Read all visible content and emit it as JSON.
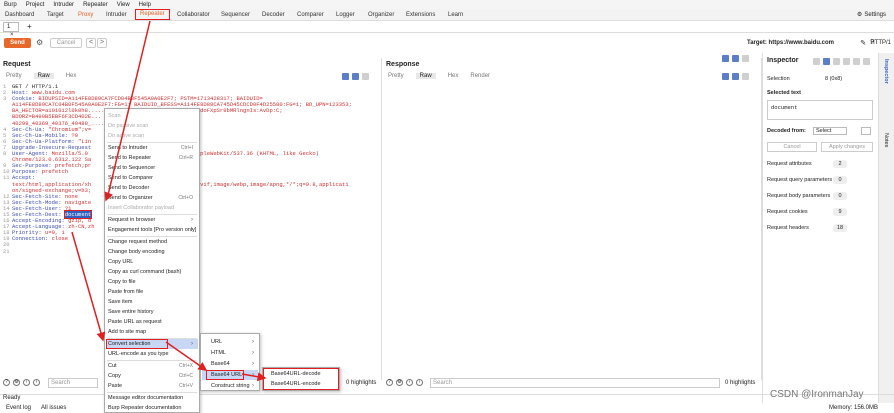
{
  "menubar": [
    "Burp",
    "Project",
    "Intruder",
    "Repeater",
    "View",
    "Help"
  ],
  "tabs": [
    "Dashboard",
    "Target",
    "Proxy",
    "Intruder",
    "Repeater",
    "Collaborator",
    "Sequencer",
    "Decoder",
    "Comparer",
    "Logger",
    "Organizer",
    "Extensions",
    "Learn"
  ],
  "settings_label": "Settings",
  "subtab": {
    "label": "1",
    "close": "×",
    "add": "+"
  },
  "toolbar": {
    "send": "Send",
    "cancel": "Cancel",
    "back": "<",
    "forward": ">",
    "target": "Target: https://www.baidu.com",
    "http": "HTTP/1"
  },
  "request": {
    "title": "Request",
    "tabs": [
      "Pretty",
      "Raw",
      "Hex"
    ],
    "lines": [
      [
        "1",
        "GET / HTTP/1.1",
        ""
      ],
      [
        "2",
        "Host: ",
        "www.baidu.com"
      ],
      [
        "3",
        "Cookie: ",
        "BIDUPSID=A114FE8D89CA7FCD04B0F545A0A0E2F7; PSTM=1713428317; BAIDUID="
      ],
      [
        "",
        "",
        "A114FE8D89CA7C04B0F545A0A0E2F7:FG=1; BAIDUID_BFESS=A114FE8D89CA745D45CDCD0F4D25580:FG=1; BD_UPN=123353;"
      ],
      [
        "",
        "",
        "BA_HECTOR=a101012l0k0h8...........rgnq0l;Gvj0y0dK8AoTaFRsdoFXpSr9bMRlngnIs:AvDp:C;"
      ],
      [
        "",
        "",
        "BDORZ=B490B5EBF6F3CD402E..."
      ],
      [
        "",
        "",
        "40299_40369_40376_40480_........9983"
      ],
      [
        "4",
        "Sec-Ch-Ua: ",
        "\"Chromium\";v="
      ],
      [
        "5",
        "Sec-Ch-Ua-Mobile: ",
        "?0"
      ],
      [
        "6",
        "Sec-Ch-Ua-Platform: ",
        "\"Lin"
      ],
      [
        "7",
        "Upgrade-Insecure-Request",
        ""
      ],
      [
        "8",
        "User-Agent: ",
        "Mozilla/5.0                                  pleWebKit/537.36 (KHTML, like Gecko)"
      ],
      [
        "",
        "",
        "Chrome/123.0.6312.122 Sa"
      ],
      [
        "9",
        "Sec-Purpose: ",
        "prefetch;pr"
      ],
      [
        "10",
        "Purpose: ",
        "prefetch"
      ],
      [
        "11",
        "Accept: ",
        ""
      ],
      [
        "",
        "",
        "text/html,application/xh                           mage/avif,image/webp,image/apng,*/*;q=0.8,applicati"
      ],
      [
        "",
        "",
        "on/signed-exchange;v=b3;"
      ],
      [
        "12",
        "Sec-Fetch-Site: ",
        "none"
      ],
      [
        "13",
        "Sec-Fetch-Mode: ",
        "navigate"
      ],
      [
        "14",
        "Sec-Fetch-User: ",
        "?1"
      ],
      [
        "15",
        "Sec-Fetch-Dest: ",
        "document"
      ],
      [
        "16",
        "Accept-Encoding: ",
        "gzip, d"
      ],
      [
        "17",
        "Accept-Language: ",
        "zh-CN,zh"
      ],
      [
        "18",
        "Priority: ",
        "u=0, i"
      ],
      [
        "19",
        "Connection: ",
        "close"
      ],
      [
        "20",
        "",
        ""
      ],
      [
        "21",
        "",
        ""
      ]
    ],
    "search_placeholder": "Search",
    "highlights": "0 highlights"
  },
  "response": {
    "title": "Response",
    "tabs": [
      "Pretty",
      "Raw",
      "Hex",
      "Render"
    ],
    "search_placeholder": "Search",
    "highlights": "0 highlights"
  },
  "inspector": {
    "title": "Inspector",
    "selection_label": "Selection",
    "selection_value": "8 (0x8)",
    "selected_text_label": "Selected text",
    "selected_text": "document",
    "decoded_from_label": "Decoded from:",
    "decoded_from_value": "Select",
    "cancel": "Cancel",
    "apply": "Apply changes",
    "rows": [
      {
        "label": "Request attributes",
        "count": "2"
      },
      {
        "label": "Request query parameters",
        "count": "0"
      },
      {
        "label": "Request body parameters",
        "count": "0"
      },
      {
        "label": "Request cookies",
        "count": "9"
      },
      {
        "label": "Request headers",
        "count": "18"
      }
    ]
  },
  "side_tabs": [
    "Inspector",
    "Notes"
  ],
  "context_menu": {
    "items": [
      {
        "label": "Scan",
        "disabled": true
      },
      {
        "label": "Do passive scan",
        "disabled": true
      },
      {
        "label": "Do active scan",
        "disabled": true
      },
      {
        "label": "Send to Intruder",
        "shortcut": "Ctrl+I"
      },
      {
        "label": "Send to Repeater",
        "shortcut": "Ctrl+R"
      },
      {
        "label": "Send to Sequencer"
      },
      {
        "label": "Send to Comparer"
      },
      {
        "label": "Send to Decoder"
      },
      {
        "label": "Send to Organizer",
        "shortcut": "Ctrl+O"
      },
      {
        "label": "Insert Collaborator payload",
        "disabled": true
      },
      {
        "label": "Request in browser",
        "arrow": true
      },
      {
        "label": "Engagement tools [Pro version only]",
        "arrow": true
      },
      {
        "label": "Change request method"
      },
      {
        "label": "Change body encoding"
      },
      {
        "label": "Copy URL"
      },
      {
        "label": "Copy as curl command (bash)"
      },
      {
        "label": "Copy to file"
      },
      {
        "label": "Paste from file"
      },
      {
        "label": "Save item"
      },
      {
        "label": "Save entire history"
      },
      {
        "label": "Paste URL as request"
      },
      {
        "label": "Add to site map"
      },
      {
        "label": "Convert selection",
        "arrow": true,
        "highlighted": true
      },
      {
        "label": "URL-encode as you type"
      },
      {
        "label": "Cut",
        "shortcut": "Ctrl+X"
      },
      {
        "label": "Copy",
        "shortcut": "Ctrl+C"
      },
      {
        "label": "Paste",
        "shortcut": "Ctrl+V"
      },
      {
        "label": "Message editor documentation"
      },
      {
        "label": "Burp Repeater documentation"
      }
    ],
    "convert_submenu": [
      "URL",
      "HTML",
      "Base64",
      "Base64 URL",
      "Construct string"
    ],
    "base64url_submenu": [
      "Base64URL-decode",
      "Base64URL-encode"
    ]
  },
  "status": {
    "ready": "Ready",
    "event_log": "Event log",
    "all_issues": "All issues",
    "memory": "Memory: 156.0MB"
  },
  "watermark": "CSDN @IronmanJay"
}
